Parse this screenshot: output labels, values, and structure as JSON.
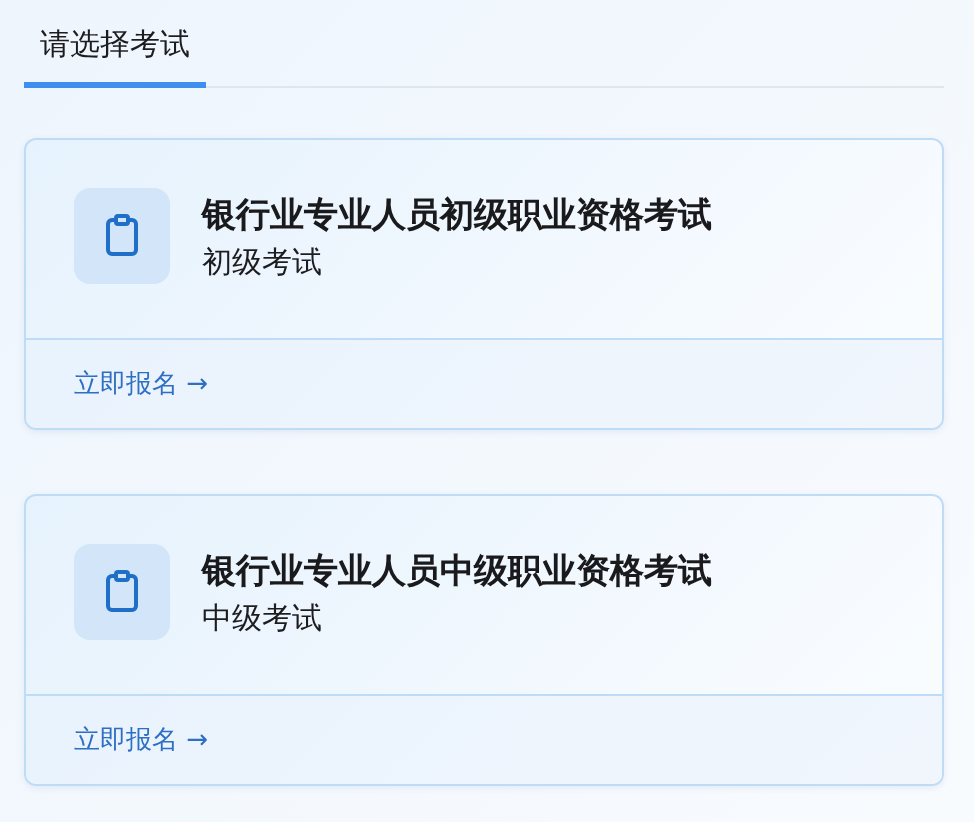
{
  "tabs": [
    {
      "label": "请选择考试",
      "selected": true
    }
  ],
  "exams": [
    {
      "title": "银行业专业人员初级职业资格考试",
      "subtitle": "初级考试",
      "action": "立即报名 →"
    },
    {
      "title": "银行业专业人员中级职业资格考试",
      "subtitle": "中级考试",
      "action": "立即报名 →"
    }
  ]
}
